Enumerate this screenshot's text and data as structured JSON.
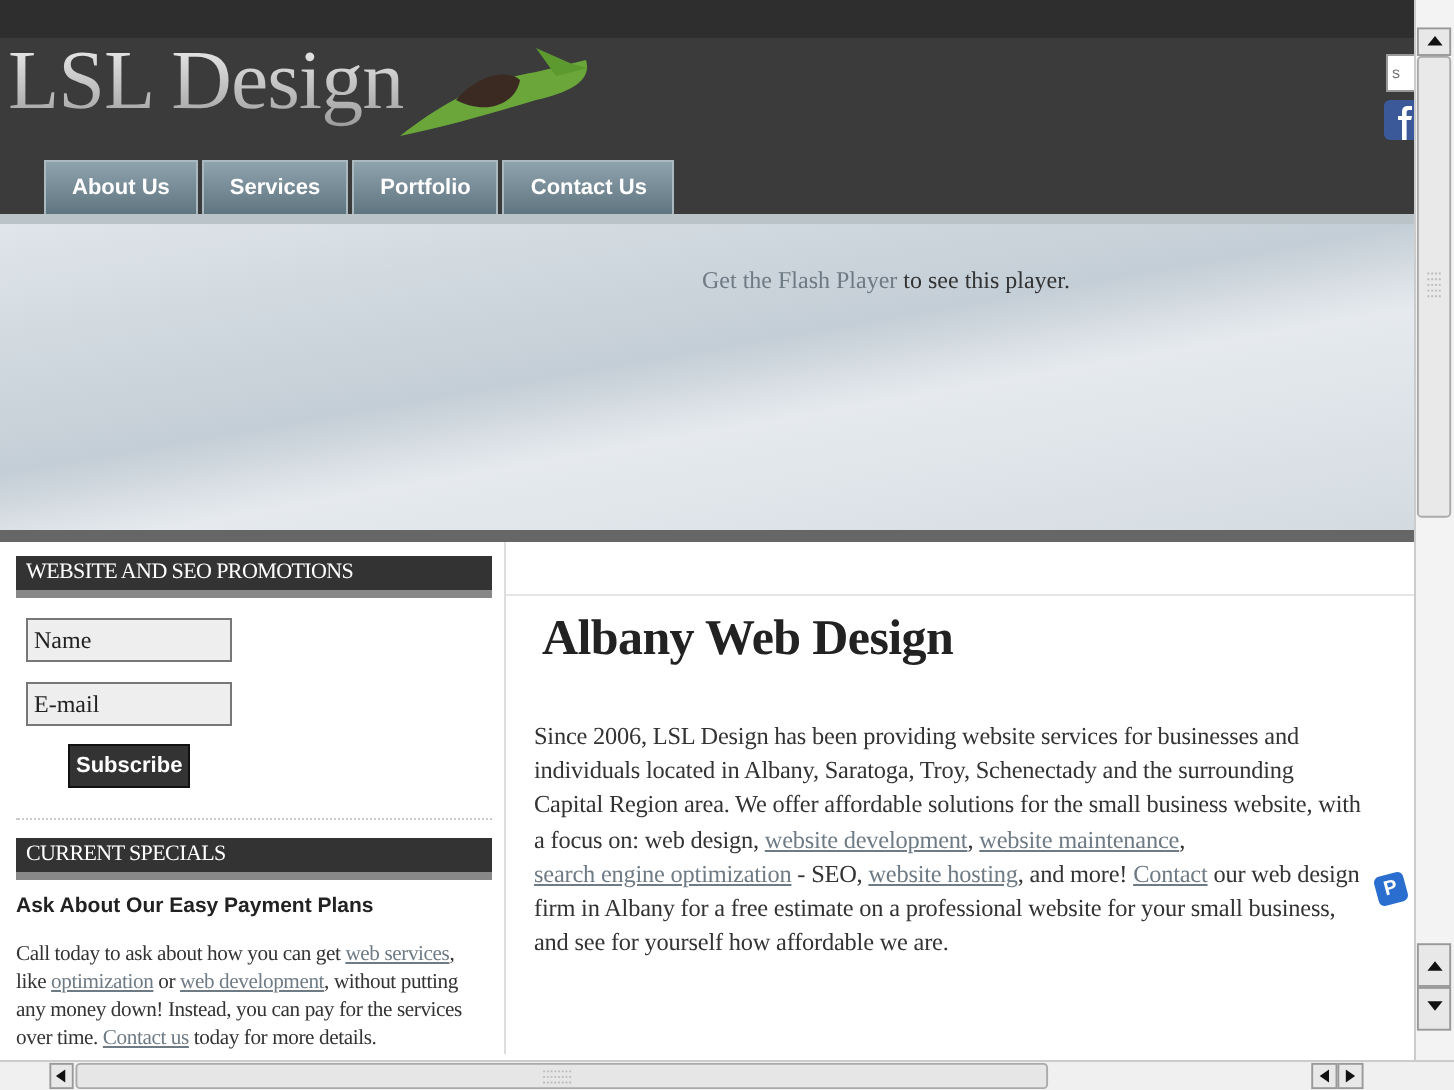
{
  "header": {
    "logo": "LSL Design",
    "search": {
      "placeholder": "s"
    },
    "nav": [
      {
        "label": "About Us",
        "selected": false
      },
      {
        "label": "Services",
        "selected": false
      },
      {
        "label": "Portfolio",
        "selected": false
      },
      {
        "label": "Contact Us",
        "selected": false
      }
    ]
  },
  "banner": {
    "notice": [
      {
        "text": "Get the Flash Player",
        "link": true
      },
      {
        "text": " to see this player.",
        "link": false
      }
    ]
  },
  "sidebar": {
    "promo_title": "WEBSITE AND SEO PROMOTIONS",
    "fields": [
      {
        "placeholder": "Name"
      },
      {
        "placeholder": "E-mail"
      }
    ],
    "subscribe": "Subscribe",
    "specials_title": "CURRENT SPECIALS",
    "specials_heading": "Ask About Our Easy Payment Plans",
    "specials_text": [
      {
        "text": "Call today to ask about how you can get ",
        "link": false
      },
      {
        "text": "web services",
        "link": true
      },
      {
        "text": ", like ",
        "link": false
      },
      {
        "text": "optimization",
        "link": true
      },
      {
        "text": " or ",
        "link": false
      },
      {
        "text": "web development",
        "link": true
      },
      {
        "text": ", without putting any money down! Instead, you can pay for the services over time. ",
        "link": false
      },
      {
        "text": "Contact us",
        "link": true
      },
      {
        "text": " today for more details.",
        "link": false
      }
    ]
  },
  "main": {
    "title": "Albany Web Design",
    "paragraph": [
      {
        "text": "Since 2006, LSL Design has been providing website services for businesses and individuals located in Albany, Saratoga, Troy, Schenectady and the surrounding Capital Region area. We offer affordable solutions for the small business website, with a focus on: web design, ",
        "link": false
      },
      {
        "text": "website development",
        "link": true
      },
      {
        "text": ", ",
        "link": false
      },
      {
        "text": "website maintenance",
        "link": true
      },
      {
        "text": ", ",
        "link": false
      },
      {
        "text": "search engine optimization",
        "link": true
      },
      {
        "text": " - SEO, ",
        "link": false
      },
      {
        "text": "website hosting",
        "link": true
      },
      {
        "text": ", and more! ",
        "link": false
      },
      {
        "text": "Contact",
        "link": true
      },
      {
        "text": " our web design firm in Albany for a free estimate on a professional website for your small business, and see for yourself how affordable we are.",
        "link": false
      }
    ]
  },
  "floating_badge": "P"
}
